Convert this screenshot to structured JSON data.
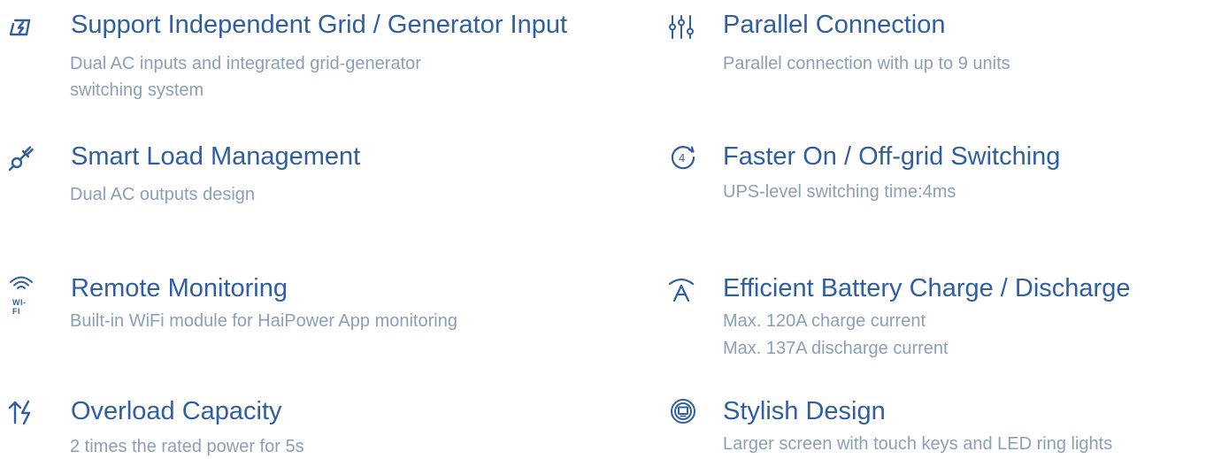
{
  "accent_color": "#2f5fa0",
  "description_color": "#8a9fb8",
  "features": [
    {
      "icon": "grid-generator-icon",
      "title": "Support Independent Grid / Generator Input",
      "lines": [
        "Dual AC inputs and integrated grid-generator",
        "switching system"
      ]
    },
    {
      "icon": "smart-plug-icon",
      "title": "Smart Load Management",
      "lines": [
        "Dual AC outputs design"
      ]
    },
    {
      "icon": "wifi-icon",
      "icon_label": "WI-FI",
      "title": "Remote Monitoring",
      "lines": [
        "Built-in WiFi module for HaiPower App monitoring"
      ]
    },
    {
      "icon": "overload-icon",
      "title": "Overload Capacity",
      "lines": [
        "2 times the rated power for 5s"
      ]
    },
    {
      "icon": "parallel-connection-icon",
      "title": "Parallel Connection",
      "lines": [
        "Parallel connection with up to 9 units"
      ]
    },
    {
      "icon": "switching-time-icon",
      "icon_label": "4",
      "title": "Faster On / Off-grid Switching",
      "lines": [
        "UPS-level switching time:4ms"
      ]
    },
    {
      "icon": "battery-charge-icon",
      "title": "Efficient Battery Charge / Discharge",
      "lines": [
        "Max. 120A charge current",
        "Max. 137A discharge current"
      ]
    },
    {
      "icon": "screen-design-icon",
      "title": "Stylish Design",
      "lines": [
        "Larger screen with touch keys and LED ring lights"
      ]
    }
  ]
}
